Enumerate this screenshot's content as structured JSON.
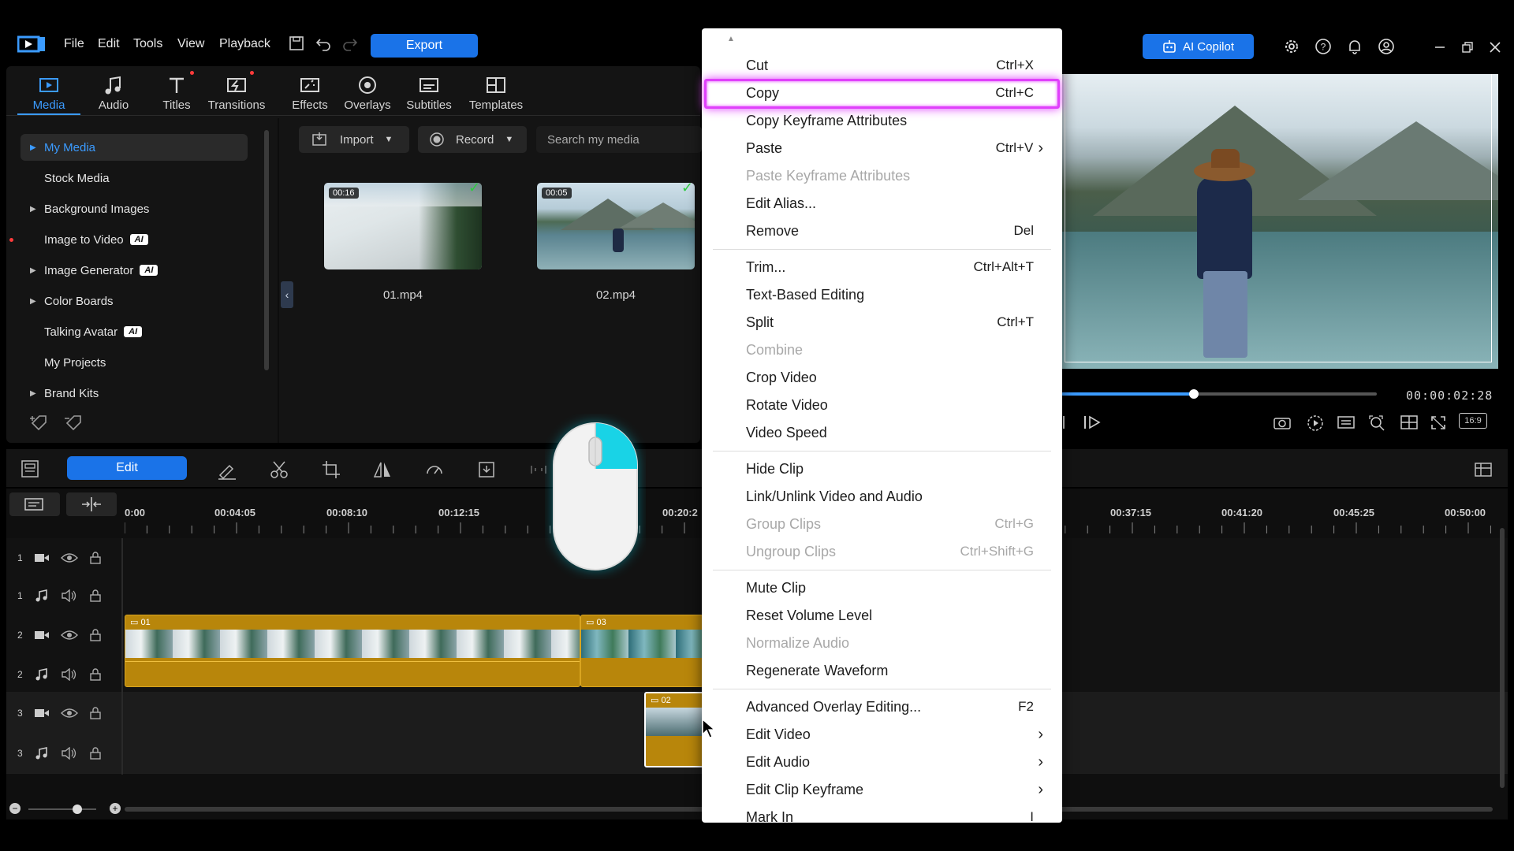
{
  "top_menu": [
    "File",
    "Edit",
    "Tools",
    "View",
    "Playback"
  ],
  "export_label": "Export",
  "copilot_label": "AI Copilot",
  "category_tabs": [
    {
      "label": "Media",
      "icon": "media-icon",
      "active": true
    },
    {
      "label": "Audio",
      "icon": "music-note-icon"
    },
    {
      "label": "Titles",
      "icon": "titles-icon",
      "dot": true
    },
    {
      "label": "Transitions",
      "icon": "transitions-icon",
      "dot": true
    },
    {
      "label": "Effects",
      "icon": "effects-icon"
    },
    {
      "label": "Overlays",
      "icon": "overlays-icon"
    },
    {
      "label": "Subtitles",
      "icon": "subtitles-icon"
    },
    {
      "label": "Templates",
      "icon": "templates-icon"
    }
  ],
  "media_tree": [
    {
      "label": "My Media",
      "arrow": true,
      "selected": true
    },
    {
      "label": "Stock Media",
      "arrow": false
    },
    {
      "label": "Background Images",
      "arrow": true
    },
    {
      "label": "Image to Video",
      "arrow": false,
      "ai": "AI",
      "red_dot": true
    },
    {
      "label": "Image Generator",
      "arrow": true,
      "ai": "AI"
    },
    {
      "label": "Color Boards",
      "arrow": true
    },
    {
      "label": "Talking Avatar",
      "arrow": false,
      "ai": "AI"
    },
    {
      "label": "My Projects",
      "arrow": false
    },
    {
      "label": "Brand Kits",
      "arrow": true
    }
  ],
  "media_toolbar": {
    "import_label": "Import",
    "record_label": "Record",
    "search_placeholder": "Search my media"
  },
  "media_items": [
    {
      "name": "01.mp4",
      "duration": "00:16",
      "checked": true
    },
    {
      "name": "02.mp4",
      "duration": "00:05",
      "checked": true
    }
  ],
  "preview": {
    "timecode": "00:00:02:28",
    "aspect": "16:9",
    "progress": 0.42
  },
  "edit_toolbar": {
    "edit_label": "Edit"
  },
  "ruler_ticks": [
    "0:00",
    "00:04:05",
    "00:08:10",
    "00:12:15",
    "00:20:2",
    "00:37:15",
    "00:41:20",
    "00:45:25",
    "00:50:00"
  ],
  "tracks": [
    {
      "num": "1",
      "type": "video"
    },
    {
      "num": "1",
      "type": "audio"
    },
    {
      "num": "2",
      "type": "video"
    },
    {
      "num": "2",
      "type": "audio"
    },
    {
      "num": "3",
      "type": "video"
    },
    {
      "num": "3",
      "type": "audio"
    }
  ],
  "clips": {
    "clip1": "01",
    "clip2": "03",
    "clip3": "02"
  },
  "context_menu": {
    "items": [
      {
        "label": "Cut",
        "shortcut": "Ctrl+X"
      },
      {
        "label": "Copy",
        "shortcut": "Ctrl+C",
        "highlighted": true
      },
      {
        "label": "Copy Keyframe Attributes",
        "shortcut": ""
      },
      {
        "label": "Paste",
        "shortcut": "Ctrl+V",
        "submenu": true
      },
      {
        "label": "Paste Keyframe Attributes",
        "shortcut": "",
        "disabled": true
      },
      {
        "label": "Edit Alias...",
        "shortcut": ""
      },
      {
        "label": "Remove",
        "shortcut": "Del"
      },
      {
        "separator": true
      },
      {
        "label": "Trim...",
        "shortcut": "Ctrl+Alt+T"
      },
      {
        "label": "Text-Based Editing",
        "shortcut": ""
      },
      {
        "label": "Split",
        "shortcut": "Ctrl+T"
      },
      {
        "label": "Combine",
        "shortcut": "",
        "disabled": true
      },
      {
        "label": "Crop Video",
        "shortcut": ""
      },
      {
        "label": "Rotate Video",
        "shortcut": ""
      },
      {
        "label": "Video Speed",
        "shortcut": ""
      },
      {
        "separator": true
      },
      {
        "label": "Hide Clip",
        "shortcut": ""
      },
      {
        "label": "Link/Unlink Video and Audio",
        "shortcut": ""
      },
      {
        "label": "Group Clips",
        "shortcut": "Ctrl+G",
        "disabled": true
      },
      {
        "label": "Ungroup Clips",
        "shortcut": "Ctrl+Shift+G",
        "disabled": true
      },
      {
        "separator": true
      },
      {
        "label": "Mute Clip",
        "shortcut": ""
      },
      {
        "label": "Reset Volume Level",
        "shortcut": ""
      },
      {
        "label": "Normalize Audio",
        "shortcut": "",
        "disabled": true
      },
      {
        "label": "Regenerate Waveform",
        "shortcut": ""
      },
      {
        "separator": true
      },
      {
        "label": "Advanced Overlay Editing...",
        "shortcut": "F2"
      },
      {
        "label": "Edit Video",
        "shortcut": "",
        "submenu": true
      },
      {
        "label": "Edit Audio",
        "shortcut": "",
        "submenu": true
      },
      {
        "label": "Edit Clip Keyframe",
        "shortcut": "",
        "submenu": true
      },
      {
        "label": "Mark In",
        "shortcut": "I"
      }
    ]
  },
  "colors": {
    "accent": "#1a73e8",
    "highlight": "#e040fb",
    "clip": "#b8860b"
  }
}
